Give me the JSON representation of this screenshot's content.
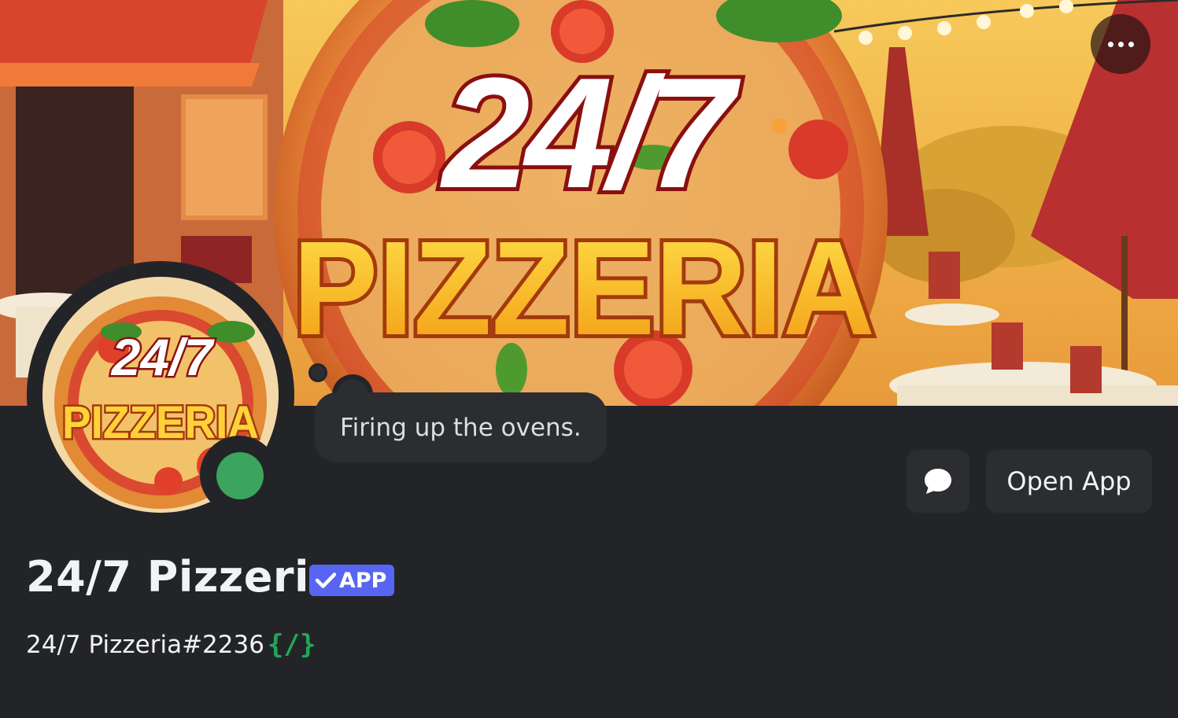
{
  "banner": {
    "logo_line1": "24/7",
    "logo_line2": "PIZZERIA"
  },
  "avatar": {
    "logo_line1": "24/7",
    "logo_line2": "PIZZERIA",
    "status": "online",
    "status_color": "#3ba55d"
  },
  "custom_status": {
    "text": "Firing up the ovens."
  },
  "actions": {
    "message_icon": "chat-bubble-icon",
    "open_app_label": "Open App",
    "more_icon": "ellipsis-icon"
  },
  "profile": {
    "display_name": "24/7 Pizzeria",
    "badge_label": "APP",
    "badge_color": "#5865f2",
    "username": "24/7 Pizzeria#2236",
    "slash_commands_badge": "{/}",
    "slash_badge_color": "#23a55a"
  }
}
